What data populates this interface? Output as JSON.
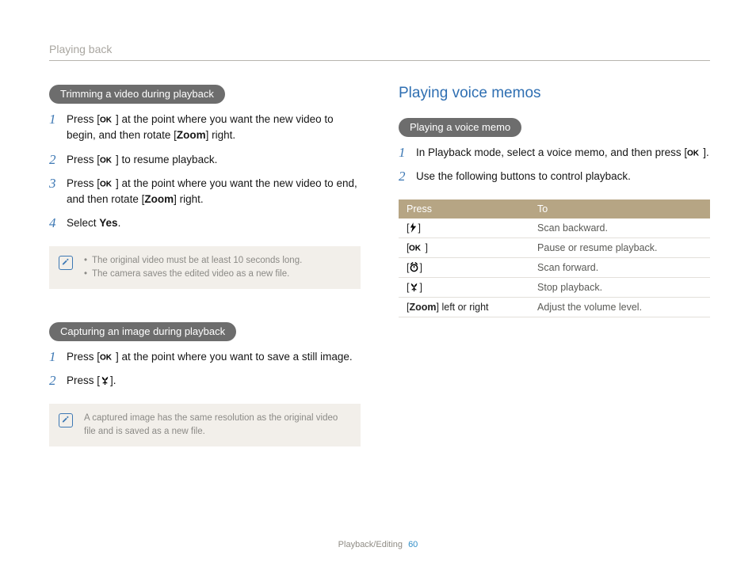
{
  "header": {
    "running": "Playing back"
  },
  "left": {
    "section1": {
      "pill": "Trimming a video during playback",
      "steps": {
        "s1a": "Press [",
        "s1b": "] at the point where you want the new video to begin, and then rotate [",
        "s1_zoom": "Zoom",
        "s1c": "] right.",
        "s2a": "Press [",
        "s2b": "] to resume playback.",
        "s3a": "Press [",
        "s3b": "] at the point where you want the new video to end, and then rotate [",
        "s3_zoom": "Zoom",
        "s3c": "] right.",
        "s4a": "Select ",
        "s4_yes": "Yes",
        "s4b": "."
      },
      "notes": {
        "n1": "The original video must be at least 10 seconds long.",
        "n2": "The camera saves the edited video as a new file."
      }
    },
    "section2": {
      "pill": "Capturing an image during playback",
      "steps": {
        "s1a": "Press [",
        "s1b": "] at the point where you want to save a still image.",
        "s2a": "Press [",
        "s2b": "]."
      },
      "note": "A captured image has the same resolution as the original video file and is saved as a new file."
    }
  },
  "right": {
    "title": "Playing voice memos",
    "pill": "Playing a voice memo",
    "steps": {
      "s1a": "In Playback mode, select a voice memo, and then press [",
      "s1b": "].",
      "s2": "Use the following buttons to control playback."
    },
    "table": {
      "h1": "Press",
      "h2": "To",
      "rows": [
        {
          "press_pre": "[",
          "icon": "flash",
          "press_post": "]",
          "to": "Scan backward."
        },
        {
          "press_pre": "[",
          "icon": "ok",
          "press_post": "]",
          "to": "Pause or resume playback."
        },
        {
          "press_pre": "[",
          "icon": "timer",
          "press_post": "]",
          "to": "Scan forward."
        },
        {
          "press_pre": "[",
          "icon": "macro",
          "press_post": "]",
          "to": "Stop playback."
        },
        {
          "press_text_pre": "[",
          "press_bold": "Zoom",
          "press_text_post": "] left or right",
          "to": "Adjust the volume level."
        }
      ]
    }
  },
  "footer": {
    "section": "Playback/Editing",
    "page": "60"
  }
}
